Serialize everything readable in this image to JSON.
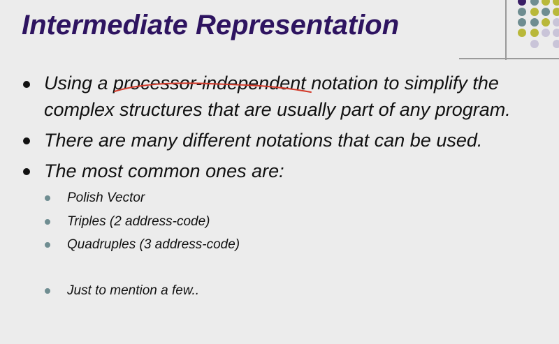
{
  "slide": {
    "title": "Intermediate Representation",
    "bullets": [
      {
        "text": "Using a processor-independent notation to simplify the complex structures that are usually part of any program."
      },
      {
        "text": "There are many different notations that can be used."
      },
      {
        "text": "The most common ones are:"
      }
    ],
    "sub_bullets": [
      {
        "text": "Polish Vector"
      },
      {
        "text": "Triples (2 address-code)"
      },
      {
        "text": "Quadruples (3 address-code)"
      },
      {
        "text": "Just to mention a few.."
      }
    ]
  },
  "colors": {
    "title": "#2e1460",
    "dot_purple": "#3a1f66",
    "dot_teal": "#6f8d91",
    "dot_olive": "#b9b83a",
    "dot_lavender": "#c9c4d8",
    "annotation_red": "#d23a2a"
  }
}
